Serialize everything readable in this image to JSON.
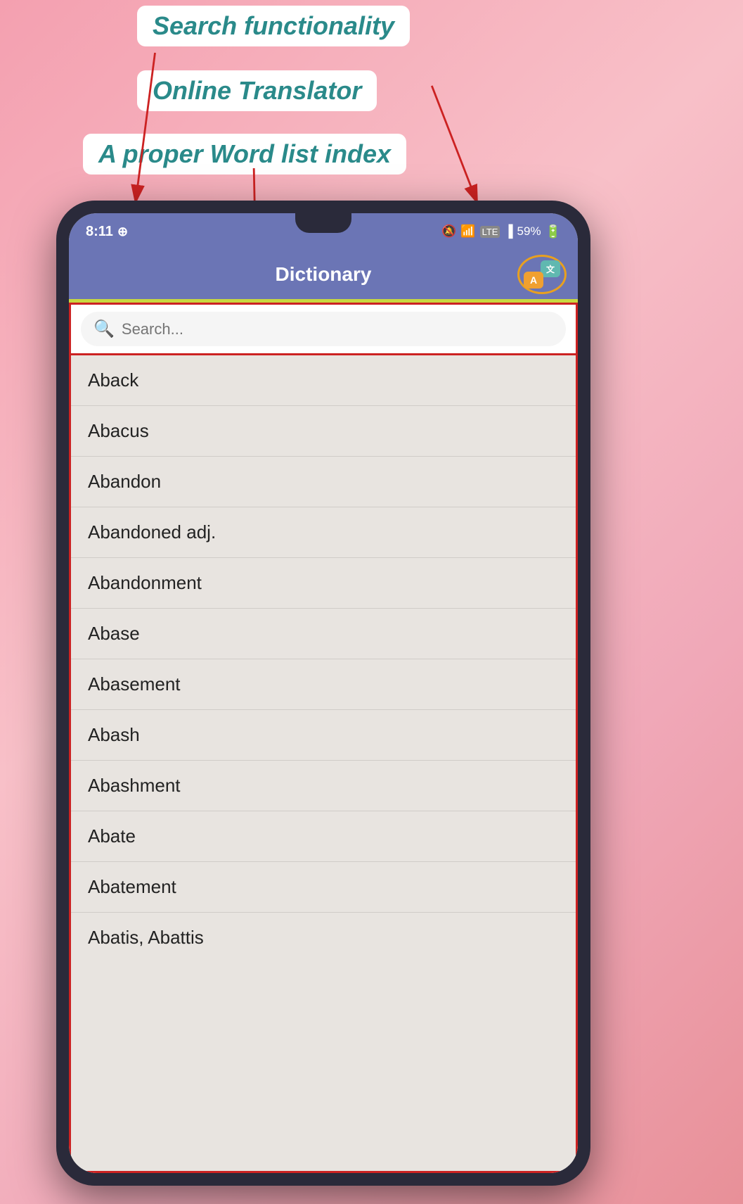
{
  "page": {
    "background": "pink gradient"
  },
  "annotations": {
    "search_label": "Search functionality",
    "translator_label": "Online Translator",
    "wordlist_label": "A proper Word list index"
  },
  "status_bar": {
    "time": "8:11",
    "whatsapp_icon": "whatsapp-icon",
    "mute_icon": "mute-icon",
    "wifi_icon": "wifi-icon",
    "signal_icon": "signal-icon",
    "battery": "59%"
  },
  "app_header": {
    "title": "Dictionary",
    "translate_button_label": "translate"
  },
  "search": {
    "placeholder": "Search..."
  },
  "word_list": {
    "items": [
      "Aback",
      "Abacus",
      "Abandon",
      "Abandoned adj.",
      "Abandonment",
      "Abase",
      "Abasement",
      "Abash",
      "Abashment",
      "Abate",
      "Abatement",
      "Abatis, Abattis"
    ]
  }
}
